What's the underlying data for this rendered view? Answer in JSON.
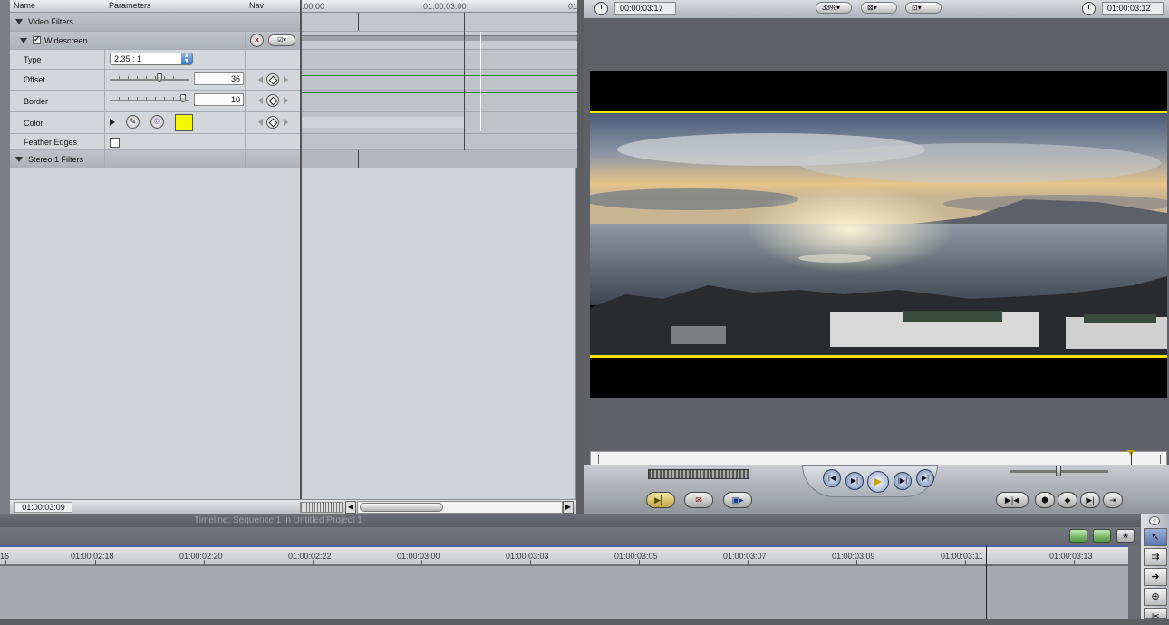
{
  "filters": {
    "columns": {
      "name": "Name",
      "parameters": "Parameters",
      "nav": "Nav"
    },
    "ruler": {
      "start": ":00:00",
      "mid": "01:00:03:00",
      "end": "01"
    },
    "group_video": "Video Filters",
    "filter_name": "Widescreen",
    "params": {
      "type": {
        "label": "Type",
        "value": "2.35 : 1"
      },
      "offset": {
        "label": "Offset",
        "value": "36"
      },
      "border": {
        "label": "Border",
        "value": "10"
      },
      "color": {
        "label": "Color",
        "swatch": "#f6f600"
      },
      "feather": {
        "label": "Feather Edges"
      }
    },
    "group_stereo": "Stereo 1 Filters",
    "current_timecode": "01:00:03:09"
  },
  "viewer": {
    "duration": "00:00:03:17",
    "zoom": "33%",
    "view_mode_icon": "frame-icon",
    "overlay_icon": "crosshair-icon",
    "current_timecode": "01:00:03:12",
    "letterbox_color": "#f6e500"
  },
  "timeline": {
    "title": "Timeline: Sequence 1 in Untitled Project 1",
    "ruler_labels": [
      "16",
      "01:00:02:18",
      "01:00:02:20",
      "01:00:02:22",
      "01:00:03:00",
      "01:00:03:03",
      "01:00:03:05",
      "01:00:03:07",
      "01:00:03:09",
      "01:00:03:11",
      "01:00:03:13"
    ]
  }
}
